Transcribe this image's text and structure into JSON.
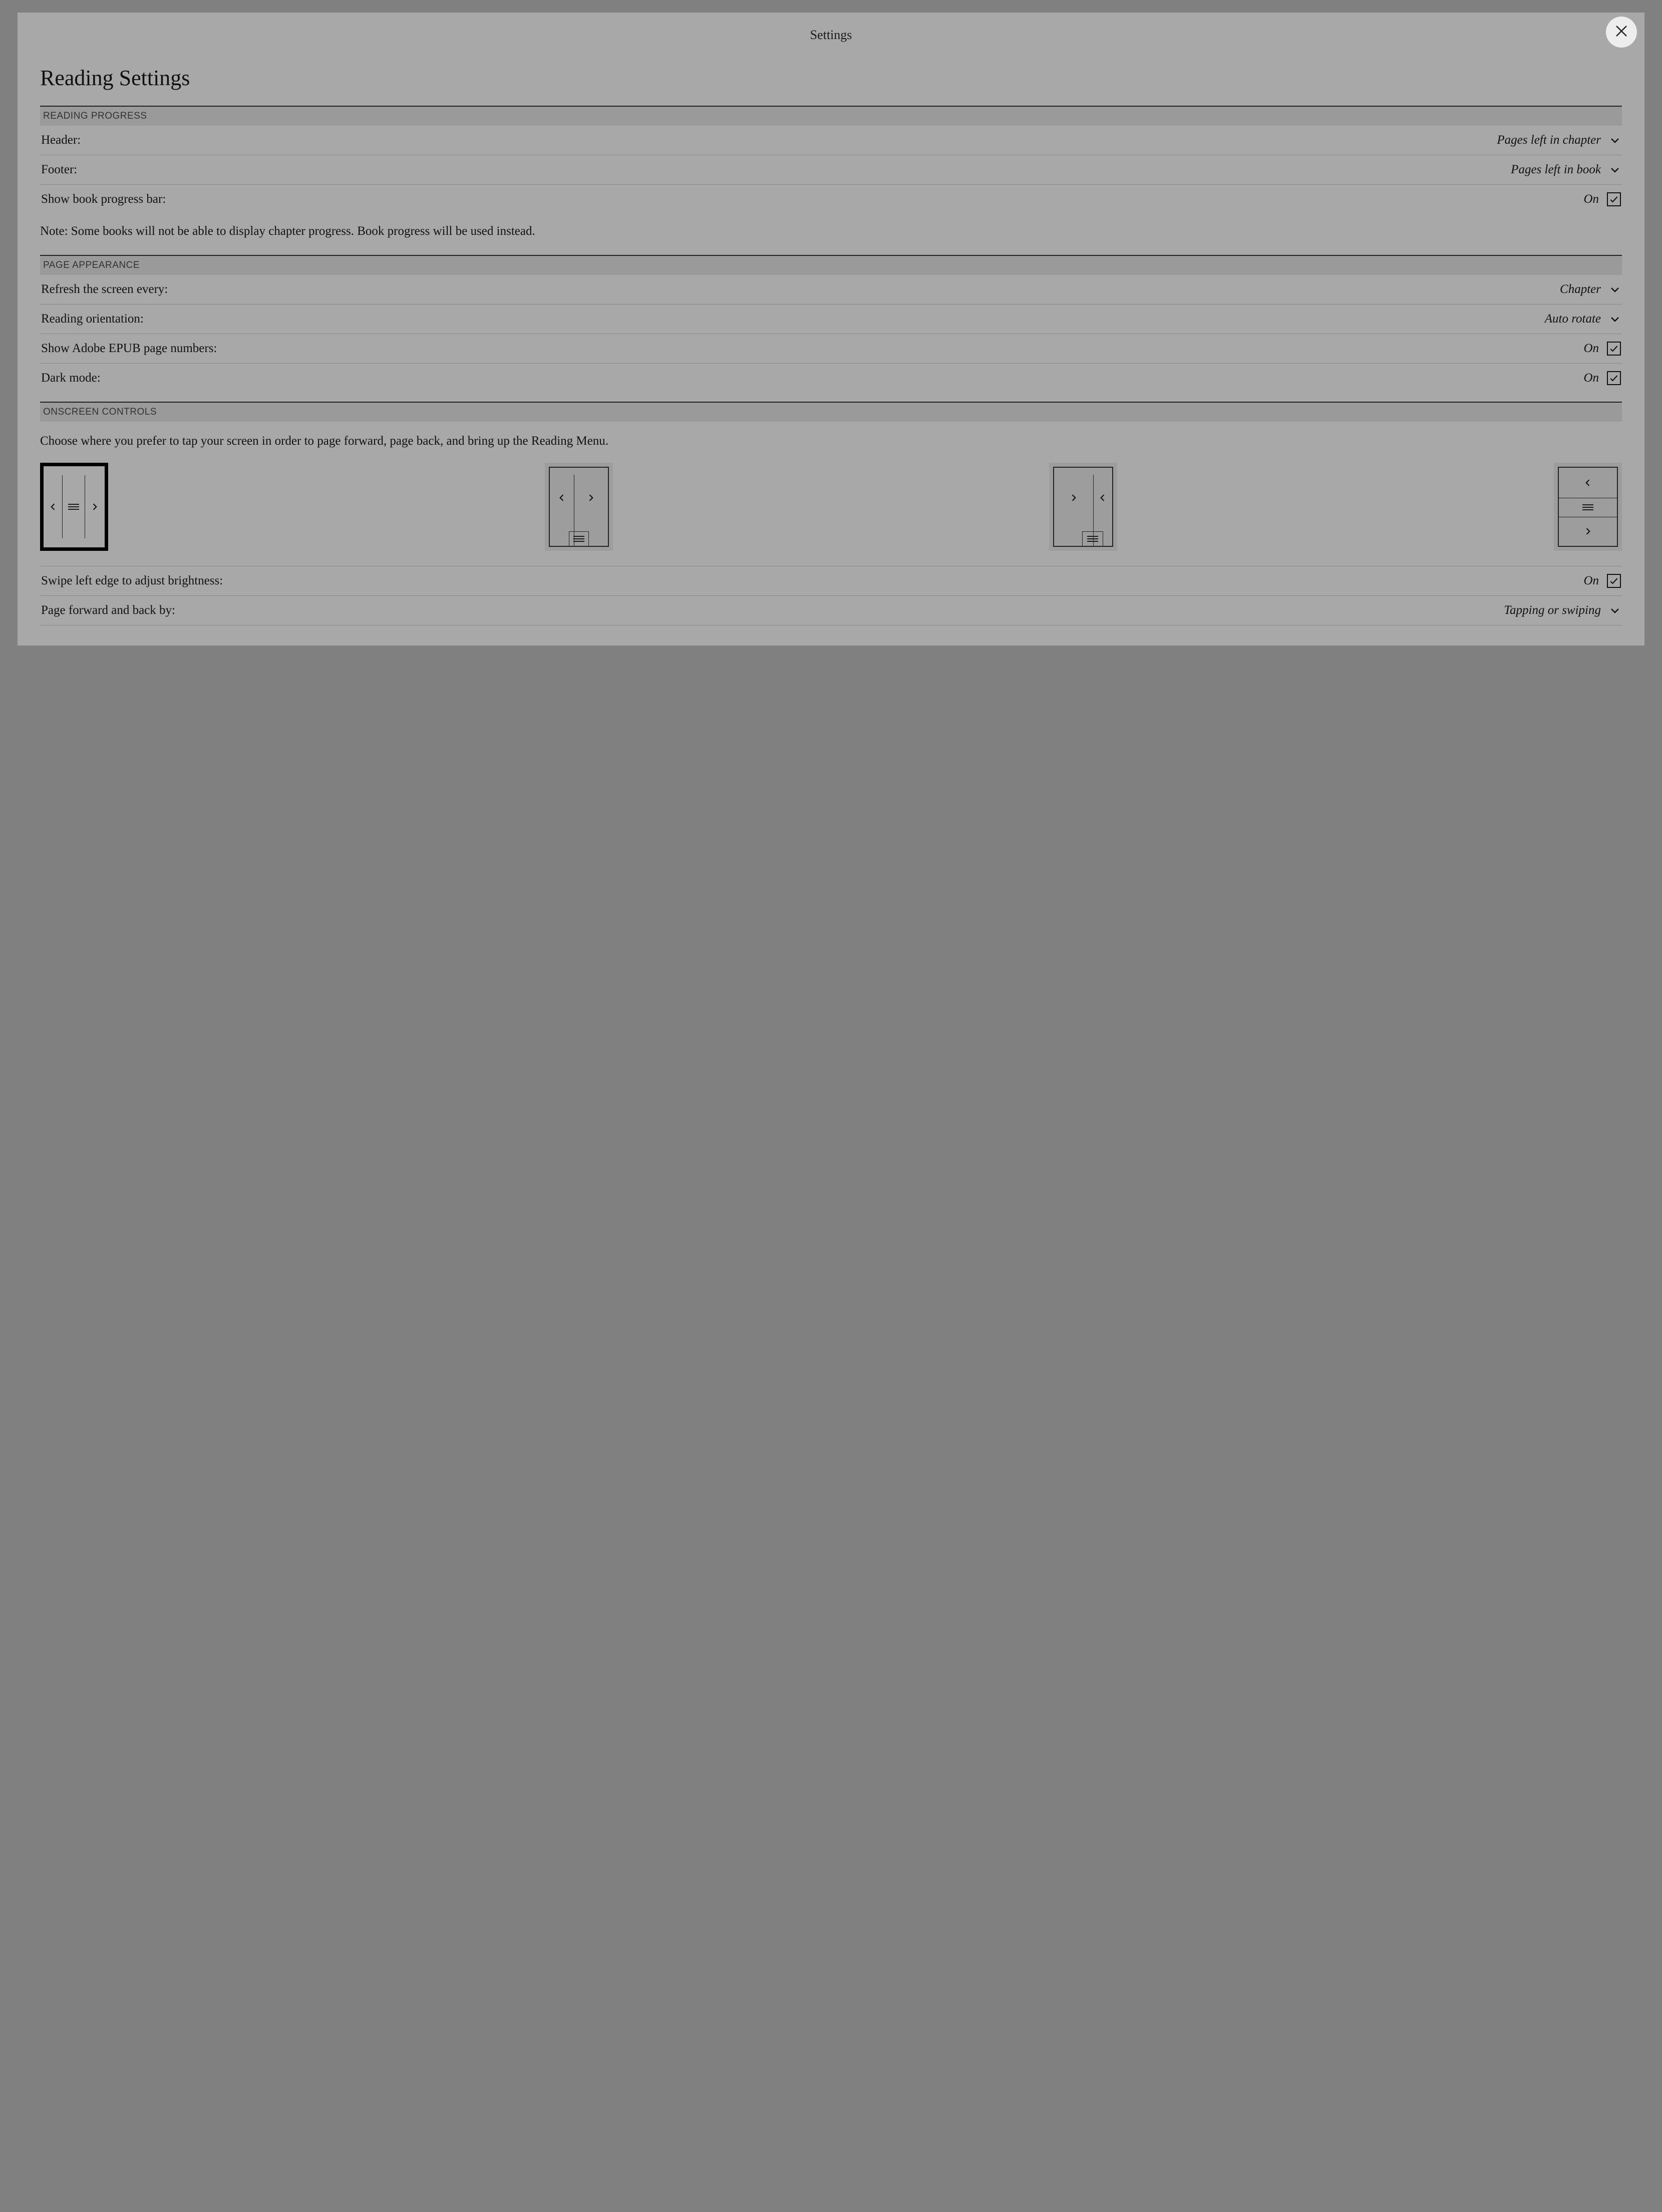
{
  "topbar": {
    "title": "Settings"
  },
  "pageTitle": "Reading Settings",
  "sections": {
    "readingProgress": {
      "header": "READING PROGRESS",
      "header_row": {
        "label": "Header:",
        "value": "Pages left in chapter"
      },
      "footer_row": {
        "label": "Footer:",
        "value": "Pages left in book"
      },
      "progress_bar_row": {
        "label": "Show book progress bar:",
        "value": "On",
        "checked": true
      },
      "note": "Note: Some books will not be able to display chapter progress. Book progress will be used instead."
    },
    "pageAppearance": {
      "header": "PAGE APPEARANCE",
      "refresh_row": {
        "label": "Refresh the screen every:",
        "value": "Chapter"
      },
      "orientation_row": {
        "label": "Reading orientation:",
        "value": "Auto rotate"
      },
      "adobe_row": {
        "label": "Show Adobe EPUB page numbers:",
        "value": "On",
        "checked": true
      },
      "dark_row": {
        "label": "Dark mode:",
        "value": "On",
        "checked": true
      }
    },
    "onscreenControls": {
      "header": "ONSCREEN CONTROLS",
      "description": "Choose where you prefer to tap your screen in order to page forward, page back, and bring up the Reading Menu.",
      "selected_layout": 0,
      "brightness_row": {
        "label": "Swipe left edge to adjust brightness:",
        "value": "On",
        "checked": true
      },
      "paging_row": {
        "label": "Page forward and back by:",
        "value": "Tapping or swiping"
      }
    }
  }
}
